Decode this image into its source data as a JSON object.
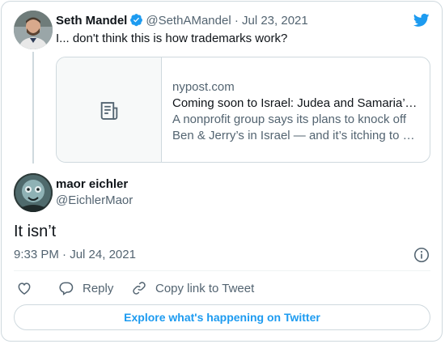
{
  "quoted_tweet": {
    "author_name": "Seth Mandel",
    "handle": "@SethAMandel",
    "separator": "·",
    "date": "Jul 23, 2021",
    "text": "I... don't think this is how trademarks work?",
    "verified": true
  },
  "link_card": {
    "domain": "nypost.com",
    "title": "Coming soon to Israel: Judea and Samaria’s own Ben & Jerry’s",
    "description": "A nonprofit group says its plans to knock off Ben & Jerry’s in Israel — and it’s itching to get started.",
    "thumb_icon": "document-icon"
  },
  "reply_tweet": {
    "author_name": "maor eichler",
    "handle": "@EichlerMaor",
    "text": "It isn’t",
    "time": "9:33 PM",
    "separator": "·",
    "date": "Jul 24, 2021"
  },
  "actions": {
    "like_icon": "heart-icon",
    "reply_label": "Reply",
    "copy_link_label": "Copy link to Tweet"
  },
  "explore_button": {
    "label": "Explore what's happening on Twitter"
  },
  "colors": {
    "accent": "#1d9bf0",
    "muted": "#536471",
    "border": "#cfd9de"
  }
}
